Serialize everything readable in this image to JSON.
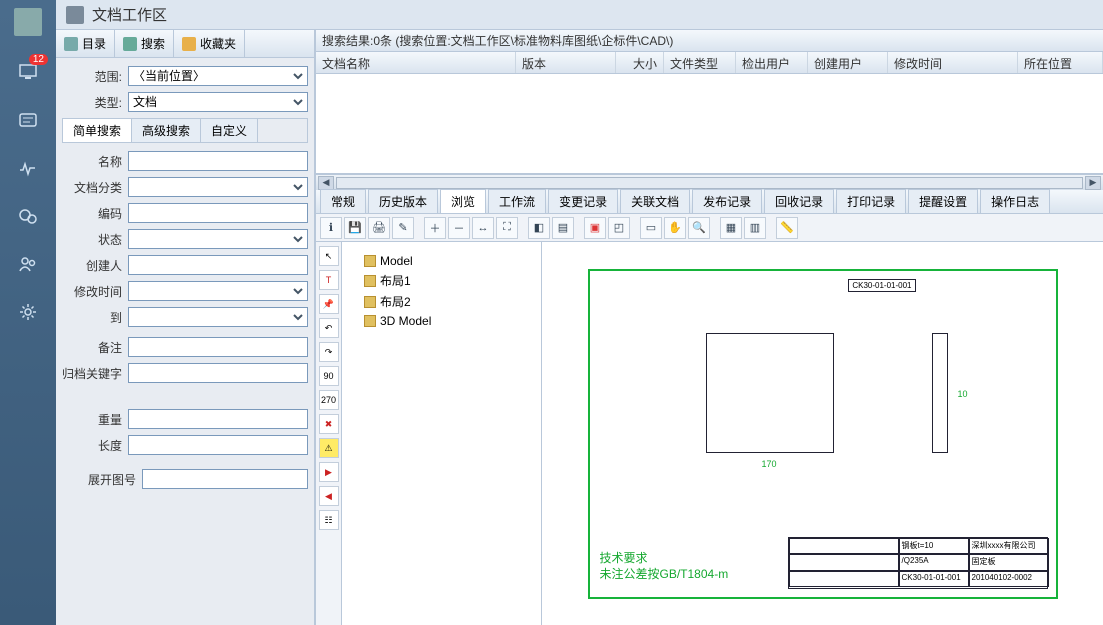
{
  "rail": {
    "badge": "12"
  },
  "header": {
    "title": "文档工作区"
  },
  "sidebar": {
    "tabs": [
      {
        "label": "目录"
      },
      {
        "label": "搜索"
      },
      {
        "label": "收藏夹"
      }
    ],
    "scope_label": "范围:",
    "scope_value": "〈当前位置〉",
    "type_label": "类型:",
    "type_value": "文档",
    "sub_tabs": [
      "简单搜索",
      "高级搜索",
      "自定义"
    ],
    "fields": {
      "name": "名称",
      "category": "文档分类",
      "code": "编码",
      "status": "状态",
      "creator": "创建人",
      "mtime": "修改时间",
      "to": "到",
      "remark": "备注",
      "archive_kw": "归档关键字",
      "weight": "重量",
      "length": "长度",
      "expand_no": "展开图号"
    }
  },
  "results": {
    "summary": "搜索结果:0条 (搜索位置:文档工作区\\标准物料库图纸\\企标件\\CAD\\)",
    "columns": [
      "文档名称",
      "版本",
      "大小",
      "文件类型",
      "检出用户",
      "创建用户",
      "修改时间",
      "所在位置"
    ]
  },
  "detail_tabs": [
    "常规",
    "历史版本",
    "浏览",
    "工作流",
    "变更记录",
    "关联文档",
    "发布记录",
    "回收记录",
    "打印记录",
    "提醒设置",
    "操作日志"
  ],
  "tree": [
    "Model",
    "布局1",
    "布局2",
    "3D Model"
  ],
  "drawing": {
    "label_top": "CK30-01-01-001",
    "dim_a": "170",
    "dim_b": "10",
    "note_title": "技术要求",
    "note_text": "未注公差按GB/T1804-m",
    "tb": {
      "mat": "钢板t=10",
      "spec": "/Q235A",
      "company": "深圳xxxx有限公司",
      "part": "固定板",
      "dwgno": "CK30-01-01-001",
      "rev": "201040102-0002"
    }
  }
}
